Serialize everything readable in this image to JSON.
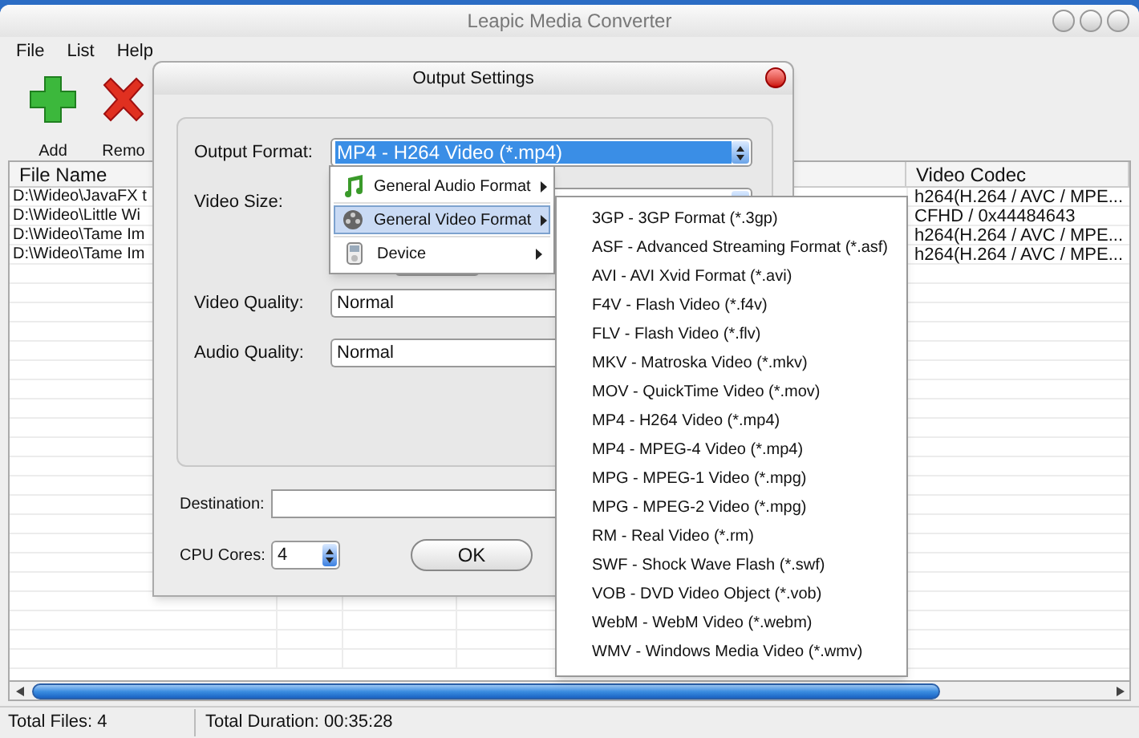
{
  "window": {
    "title": "Leapic Media Converter"
  },
  "menu_bar": [
    "File",
    "List",
    "Help"
  ],
  "toolbar": [
    {
      "label": "Add",
      "kind": "add"
    },
    {
      "label": "Remo",
      "kind": "remove"
    }
  ],
  "table": {
    "columns": [
      "File Name",
      "Video Codec"
    ],
    "rows": [
      {
        "file_name": "D:\\Wideo\\JavaFX t",
        "video_codec": "h264(H.264 / AVC / MPE..."
      },
      {
        "file_name": "D:\\Wideo\\Little Wi",
        "video_codec": "CFHD / 0x44484643"
      },
      {
        "file_name": "D:\\Wideo\\Tame Im",
        "video_codec": "h264(H.264 / AVC / MPE..."
      },
      {
        "file_name": "D:\\Wideo\\Tame Im",
        "video_codec": "h264(H.264 / AVC / MPE..."
      }
    ]
  },
  "status_bar": [
    "Total Files: 4",
    "Total Duration: 00:35:28"
  ],
  "dialog": {
    "title": "Output Settings",
    "fields": [
      {
        "label": "Output Format:",
        "kind": "select",
        "value": "MP4 - H264 Video (*.mp4)"
      },
      {
        "label": "Video Size:",
        "kind": "select"
      },
      {
        "label": "Video Quality:",
        "kind": "field",
        "value": "Normal"
      },
      {
        "label": "Audio Quality:",
        "kind": "field",
        "value": "Normal"
      }
    ],
    "destination": {
      "label": "Destination:"
    },
    "cpu_cores": {
      "label": "CPU Cores:",
      "value": "4"
    },
    "ok_button": "OK"
  },
  "format_menu": [
    {
      "label": "General Audio Format",
      "kind": "audio",
      "selected": false
    },
    {
      "label": "General Video Format",
      "kind": "video",
      "selected": true
    },
    {
      "label": "Device",
      "kind": "device",
      "selected": false
    }
  ],
  "submenu": [
    "3GP - 3GP Format (*.3gp)",
    "ASF - Advanced Streaming Format (*.asf)",
    "AVI - AVI Xvid Format (*.avi)",
    "F4V - Flash Video (*.f4v)",
    "FLV - Flash Video (*.flv)",
    "MKV - Matroska Video (*.mkv)",
    "MOV - QuickTime Video (*.mov)",
    "MP4 - H264 Video (*.mp4)",
    "MP4 - MPEG-4 Video (*.mp4)",
    "MPG - MPEG-1 Video (*.mpg)",
    "MPG - MPEG-2 Video (*.mpg)",
    "RM - Real Video (*.rm)",
    "SWF - Shock Wave Flash (*.swf)",
    "VOB - DVD Video Object (*.vob)",
    "WebM - WebM Video (*.webm)",
    "WMV - Windows Media Video (*.wmv)"
  ]
}
